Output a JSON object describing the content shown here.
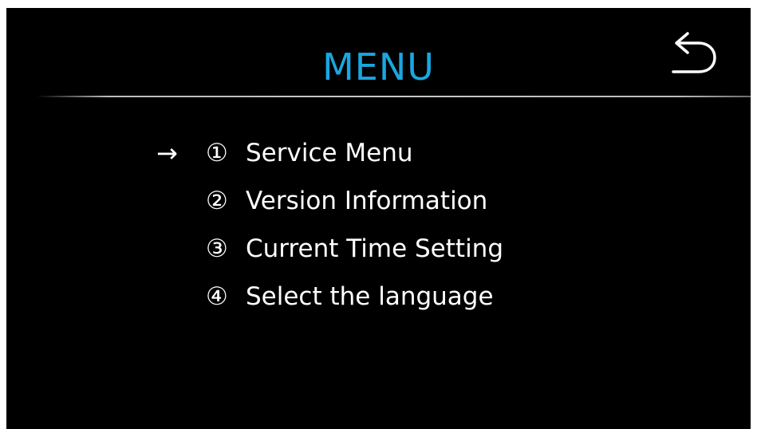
{
  "header": {
    "title": "MENU",
    "back_icon": "undo-arrow-icon"
  },
  "selection": {
    "indicator": "→",
    "selected_index": 0
  },
  "menu": {
    "items": [
      {
        "number": "①",
        "label": "Service Menu"
      },
      {
        "number": "②",
        "label": "Version Information"
      },
      {
        "number": "③",
        "label": "Current Time Setting"
      },
      {
        "number": "④",
        "label": "Select the language"
      }
    ]
  },
  "colors": {
    "background": "#000000",
    "title": "#1aa7e0",
    "text": "#ffffff"
  }
}
